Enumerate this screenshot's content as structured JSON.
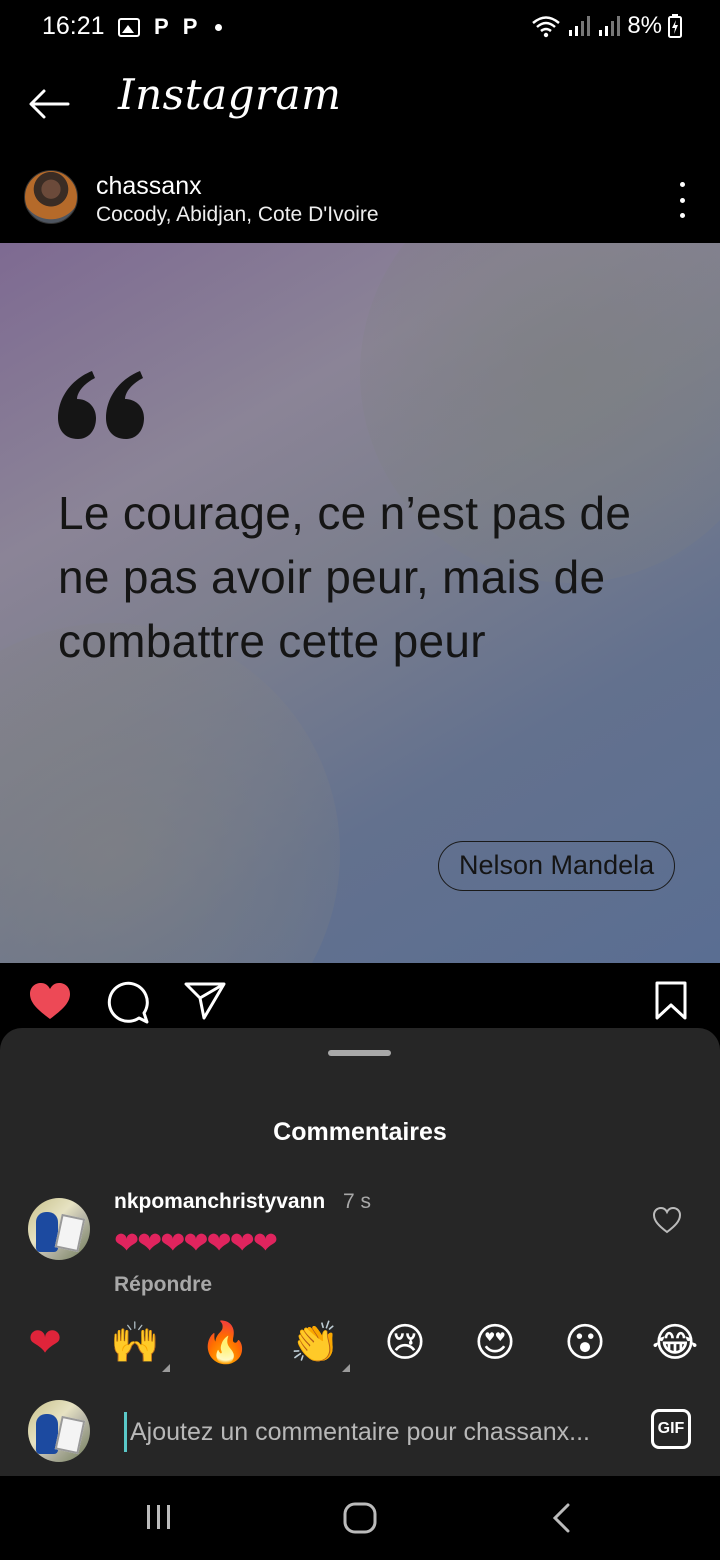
{
  "status_bar": {
    "time": "16:21",
    "notif_p1": "P",
    "notif_p2": "P",
    "battery": "8%"
  },
  "app_bar": {
    "title": "Instagram"
  },
  "post": {
    "username": "chassanx",
    "location": "Cocody, Abidjan, Cote D'Ivoire",
    "quote": "Le courage, ce n’est pas de ne pas avoir peur, mais de combattre cette peur",
    "author": "Nelson Mandela",
    "liked": true
  },
  "comments_sheet": {
    "title": "Commentaires",
    "comments": [
      {
        "username": "nkpomanchristyvann",
        "time": "7 s",
        "text": "❤❤❤❤❤❤❤",
        "reply_label": "Répondre"
      }
    ],
    "quick_emojis": [
      "❤",
      "🙌",
      "🔥",
      "👏",
      "😢",
      "😍",
      "😮",
      "😂"
    ],
    "input_placeholder": "Ajoutez un commentaire pour chassanx...",
    "gif_label": "GIF"
  },
  "colors": {
    "like_red": "#ed4956",
    "sheet_bg": "#262626",
    "muted_text": "#a8a8a8"
  }
}
